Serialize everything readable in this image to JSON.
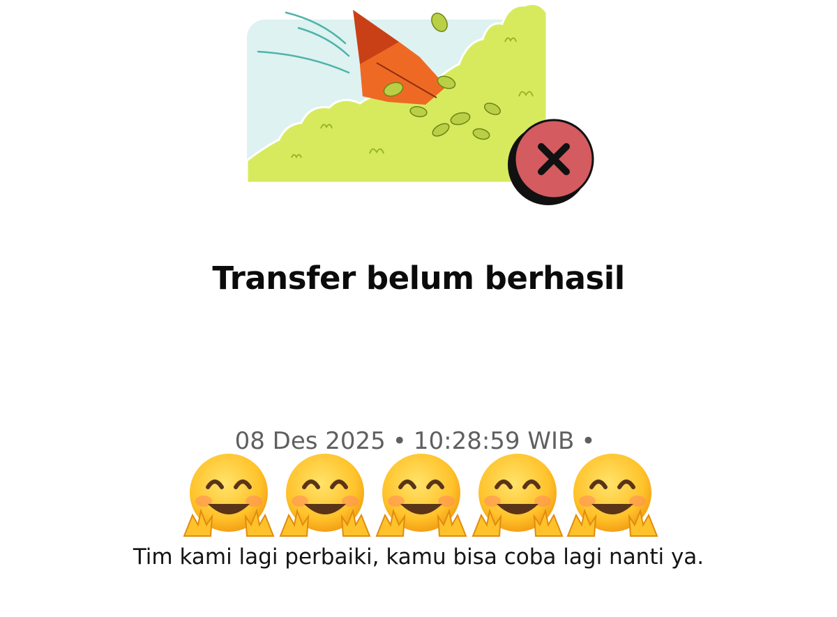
{
  "status": {
    "title": "Transfer belum berhasil",
    "icon": "failed-x-icon",
    "icon_color": "#d45b5f"
  },
  "meta": {
    "date": "08 Des 2025",
    "time": "10:28:59 WIB",
    "separator": "•"
  },
  "emojis": {
    "name": "hugging-face-icon",
    "count": 5
  },
  "message": "Tim kami lagi perbaiki, kamu bisa coba lagi nanti ya.",
  "colors": {
    "sky": "#dff2f0",
    "grass": "#d7ea5e",
    "kite": "#ee6a24"
  }
}
